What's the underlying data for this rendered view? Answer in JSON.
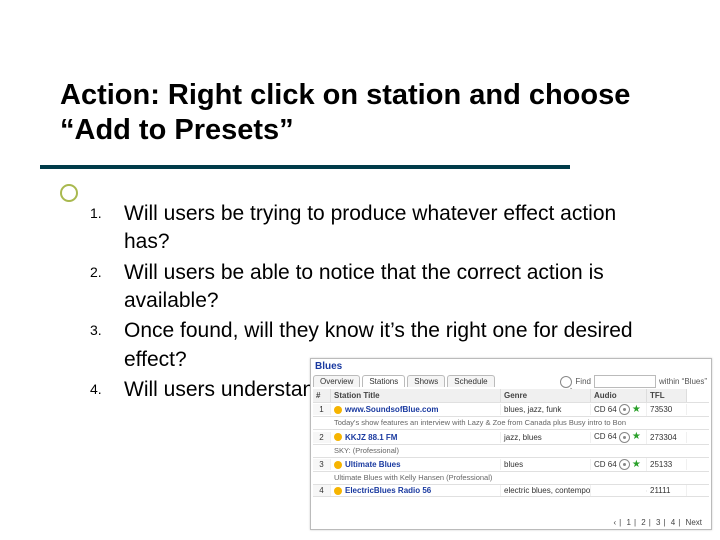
{
  "title": "Action: Right click on station and choose “Add to Presets”",
  "items": [
    {
      "num": "1.",
      "txt": "Will users be trying to produce whatever effect action has?"
    },
    {
      "num": "2.",
      "txt": "Will users be able to notice that the correct action is available?"
    },
    {
      "num": "3.",
      "txt": "Once found, will they know it’s the right one for desired effect?"
    },
    {
      "num": "4.",
      "txt": "Will users understand feedback after action?"
    }
  ],
  "app": {
    "title": "Blues",
    "tabs": [
      "Overview",
      "Stations",
      "Shows",
      "Schedule"
    ],
    "active_tab": 1,
    "search": {
      "label_prefix": "Find",
      "label_suffix": "within “Blues”"
    },
    "columns": [
      "#",
      "Station Title",
      "Genre",
      "Audio",
      "TFL"
    ],
    "rows": [
      {
        "n": "1",
        "title": "www.SoundsofBlue.com",
        "genre": "blues, jazz, funk",
        "audio": "CD 64",
        "tfl": "73530",
        "desc": "Today's show features an interview with Lazy & Zoe from Canada plus Busy intro to Bon"
      },
      {
        "n": "2",
        "title": "KKJZ 88.1 FM",
        "genre": "jazz, blues",
        "audio": "CD 64",
        "tfl": "273304",
        "desc": "SKY: (Professional)"
      },
      {
        "n": "3",
        "title": "Ultimate Blues",
        "genre": "blues",
        "audio": "CD 64",
        "tfl": "25133",
        "desc": "Ultimate Blues with Kelly Hansen (Professional)"
      },
      {
        "n": "4",
        "title": "ElectricBlues Radio 56",
        "genre": "electric blues, contempo",
        "audio": "",
        "tfl": "21111",
        "desc": ""
      }
    ],
    "footer": {
      "pages": [
        "1",
        "2",
        "3",
        "4"
      ],
      "prev": "‹",
      "next": "Next"
    }
  }
}
